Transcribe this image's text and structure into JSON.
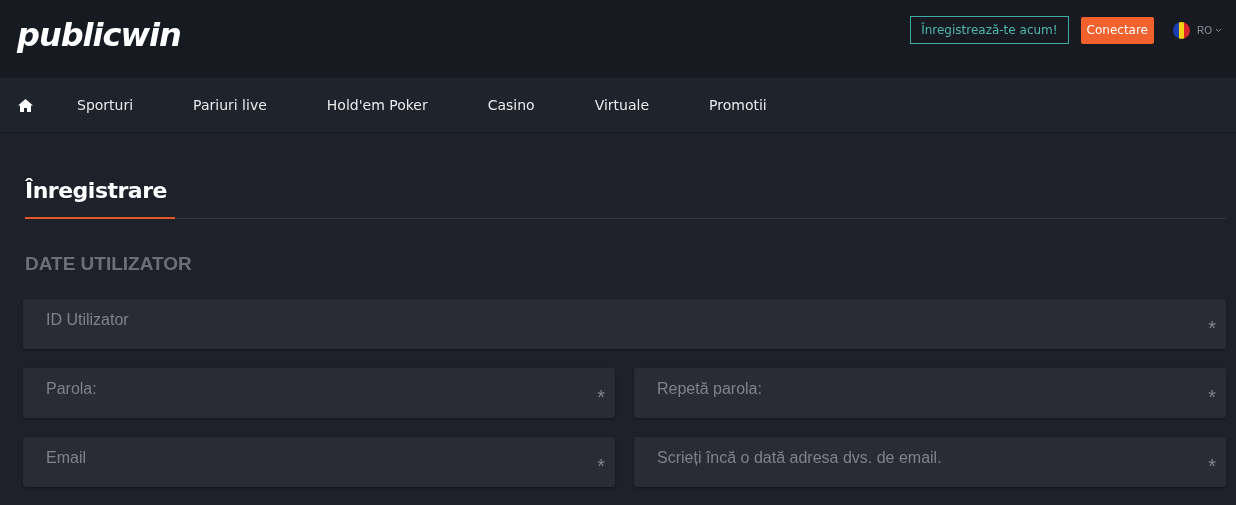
{
  "header": {
    "logo": "publicwin",
    "register_button": "Înregistrează-te acum!",
    "login_button": "Conectare",
    "language": "RO"
  },
  "nav": {
    "items": [
      {
        "label": "Sporturi"
      },
      {
        "label": "Pariuri live"
      },
      {
        "label": "Hold'em Poker"
      },
      {
        "label": "Casino"
      },
      {
        "label": "Virtuale"
      },
      {
        "label": "Promotii"
      }
    ]
  },
  "tabs": [
    {
      "label": "Înregistrare",
      "selected": true
    }
  ],
  "section_title": "DATE UTILIZATOR",
  "form_rows": [
    {
      "fields": [
        {
          "placeholder": "ID Utilizator",
          "required_mark": "*"
        }
      ]
    },
    {
      "fields": [
        {
          "placeholder": "Parola:",
          "required_mark": "*"
        },
        {
          "placeholder": "Repetă parola:",
          "required_mark": "*"
        }
      ]
    },
    {
      "fields": [
        {
          "placeholder": "Email",
          "required_mark": "*"
        },
        {
          "placeholder": "Scrieți încă o dată adresa dvs. de email.",
          "required_mark": "*"
        }
      ]
    }
  ]
}
